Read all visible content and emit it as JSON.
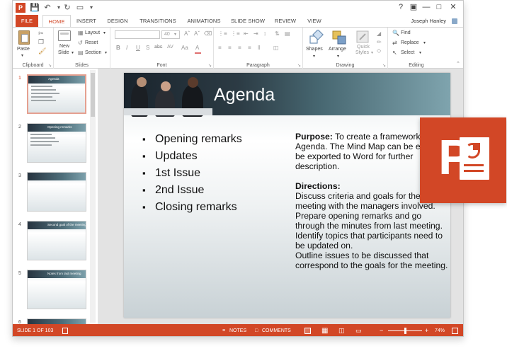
{
  "window": {
    "user_name": "Joseph Hanley"
  },
  "quick_access": {
    "icons": [
      "app-icon",
      "save-icon",
      "undo-icon",
      "redo-icon",
      "start-from-beginning-icon",
      "customize-icon"
    ]
  },
  "window_controls": {
    "icons": [
      "help-icon",
      "ribbon-display-icon",
      "minimize-icon",
      "maximize-icon",
      "close-icon"
    ]
  },
  "tabs": [
    {
      "label": "FILE"
    },
    {
      "label": "HOME"
    },
    {
      "label": "INSERT"
    },
    {
      "label": "DESIGN"
    },
    {
      "label": "TRANSITIONS"
    },
    {
      "label": "ANIMATIONS"
    },
    {
      "label": "SLIDE SHOW"
    },
    {
      "label": "REVIEW"
    },
    {
      "label": "VIEW"
    }
  ],
  "ribbon": {
    "clipboard": {
      "label": "Clipboard",
      "paste": "Paste"
    },
    "slides": {
      "label": "Slides",
      "new_slide_line1": "New",
      "new_slide_line2": "Slide",
      "layout": "Layout",
      "reset": "Reset",
      "section": "Section"
    },
    "font": {
      "label": "Font",
      "size": "40",
      "bold": "B",
      "italic": "I",
      "underline": "U",
      "strike": "S",
      "shadow": "abc",
      "spacing": "AV",
      "case": "Aa",
      "color": "A"
    },
    "paragraph": {
      "label": "Paragraph"
    },
    "drawing": {
      "label": "Drawing",
      "shapes": "Shapes",
      "arrange": "Arrange",
      "quick_styles_line1": "Quick",
      "quick_styles_line2": "Styles"
    },
    "editing": {
      "label": "Editing",
      "find": "Find",
      "replace": "Replace",
      "select": "Select"
    }
  },
  "thumbnails": [
    {
      "number": "1",
      "title": "Agenda",
      "selected": true,
      "lines": 5
    },
    {
      "number": "2",
      "title": "Opening remarks",
      "selected": false,
      "lines": 4
    },
    {
      "number": "3",
      "title": "",
      "selected": false,
      "lines": 0
    },
    {
      "number": "4",
      "title": "Second goal of the meeting",
      "selected": false,
      "lines": 0
    },
    {
      "number": "5",
      "title": "Notes from last meeting",
      "selected": false,
      "lines": 0
    },
    {
      "number": "6",
      "title": "",
      "selected": false,
      "lines": 0
    }
  ],
  "slide": {
    "title": "Agenda",
    "bullets": [
      "Opening remarks",
      "Updates",
      "1st Issue",
      "2nd Issue",
      "Closing remarks"
    ],
    "purpose_label": "Purpose:",
    "purpose_text": " To create a framework for an Agenda. The Mind Map can be easily be exported to Word for further description.",
    "directions_label": "Directions:",
    "directions": [
      "Discuss criteria and goals for the meeting with the managers involved.",
      "Prepare opening remarks and go through the minutes from last meeting.",
      "Identify topics that participants need to be updated on.",
      "Outline issues to be discussed that correspond to the goals for the meeting."
    ]
  },
  "statusbar": {
    "slide_counter": "SLIDE 1 OF 103",
    "notes": "NOTES",
    "comments": "COMMENTS",
    "zoom_percent": "74%",
    "zoom_level": 0.74
  },
  "logo": {
    "letter": "P"
  },
  "colors": {
    "accent": "#d24726"
  }
}
